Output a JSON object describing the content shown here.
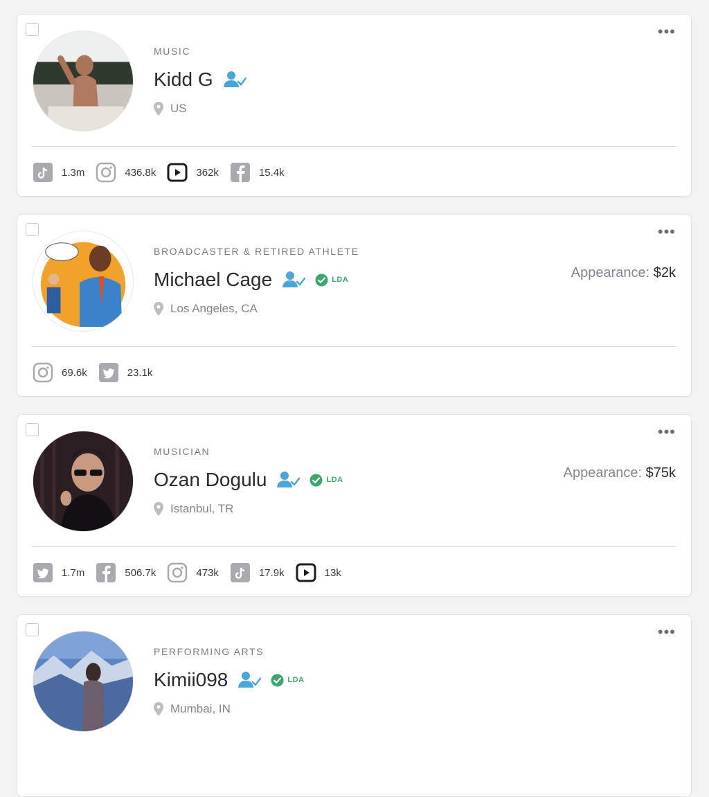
{
  "colors": {
    "accent_blue": "#4aa6d6",
    "lda_green": "#3aa86b",
    "social_gray": "#a9a9ae",
    "youtube_black": "#1c1c1e"
  },
  "cards": [
    {
      "category": "MUSIC",
      "name": "Kidd G",
      "location": "US",
      "appearance_label": "",
      "appearance_fee": "",
      "lda": "",
      "stats": [
        {
          "icon": "tiktok-icon",
          "value": "1.3m"
        },
        {
          "icon": "instagram-icon",
          "value": "436.8k"
        },
        {
          "icon": "youtube-icon",
          "value": "362k"
        },
        {
          "icon": "facebook-icon",
          "value": "15.4k"
        }
      ]
    },
    {
      "category": "BROADCASTER & RETIRED ATHLETE",
      "name": "Michael Cage",
      "location": "Los Angeles, CA",
      "appearance_label": "Appearance: ",
      "appearance_fee": "$2k",
      "lda": "LDA",
      "stats": [
        {
          "icon": "instagram-icon",
          "value": "69.6k"
        },
        {
          "icon": "twitter-icon",
          "value": "23.1k"
        }
      ]
    },
    {
      "category": "MUSICIAN",
      "name": "Ozan Dogulu",
      "location": "Istanbul, TR",
      "appearance_label": "Appearance: ",
      "appearance_fee": "$75k",
      "lda": "LDA",
      "stats": [
        {
          "icon": "twitter-icon",
          "value": "1.7m"
        },
        {
          "icon": "facebook-icon",
          "value": "506.7k"
        },
        {
          "icon": "instagram-icon",
          "value": "473k"
        },
        {
          "icon": "tiktok-icon",
          "value": "17.9k"
        },
        {
          "icon": "youtube-icon",
          "value": "13k"
        }
      ]
    },
    {
      "category": "PERFORMING ARTS",
      "name": "Kimii098",
      "location": "Mumbai, IN",
      "appearance_label": "",
      "appearance_fee": "",
      "lda": "LDA",
      "stats": []
    }
  ]
}
